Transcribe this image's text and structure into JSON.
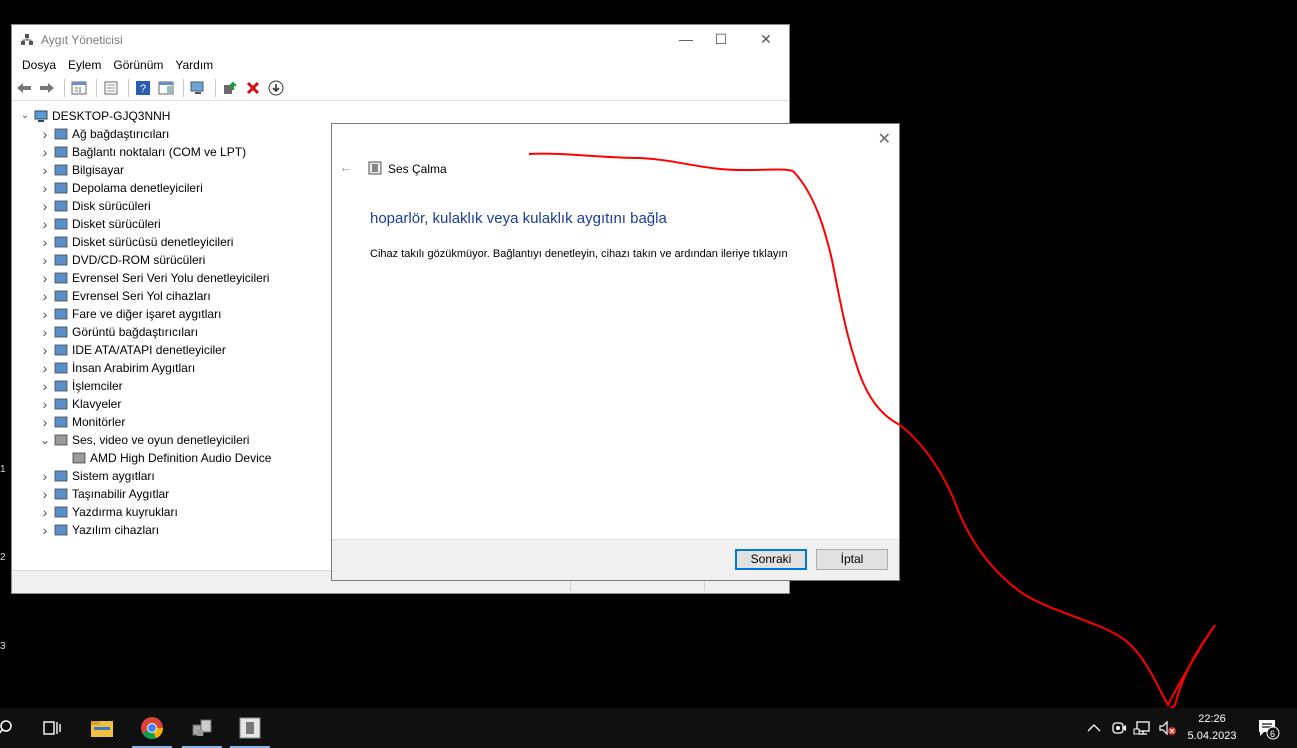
{
  "desktop": {
    "edge_glyphs": [
      "1",
      "2",
      "3"
    ]
  },
  "devmgr": {
    "title": "Aygıt Yöneticisi",
    "menu": [
      "Dosya",
      "Eylem",
      "Görünüm",
      "Yardım"
    ],
    "tree": {
      "root": "DESKTOP-GJQ3NNH",
      "items": [
        {
          "label": "Ağ bağdaştırıcıları",
          "icon": "network-adapter-icon"
        },
        {
          "label": "Bağlantı noktaları (COM ve LPT)",
          "icon": "port-icon"
        },
        {
          "label": "Bilgisayar",
          "icon": "computer-icon"
        },
        {
          "label": "Depolama denetleyicileri",
          "icon": "storage-icon"
        },
        {
          "label": "Disk sürücüleri",
          "icon": "disk-icon"
        },
        {
          "label": "Disket sürücüleri",
          "icon": "floppy-icon"
        },
        {
          "label": "Disket sürücüsü denetleyicileri",
          "icon": "floppy-controller-icon"
        },
        {
          "label": "DVD/CD-ROM sürücüleri",
          "icon": "dvd-icon"
        },
        {
          "label": "Evrensel Seri Veri Yolu denetleyicileri",
          "icon": "usb-icon"
        },
        {
          "label": "Evrensel Seri Yol cihazları",
          "icon": "usb-device-icon"
        },
        {
          "label": "Fare ve diğer işaret aygıtları",
          "icon": "mouse-icon"
        },
        {
          "label": "Görüntü bağdaştırıcıları",
          "icon": "display-adapter-icon"
        },
        {
          "label": "IDE ATA/ATAPI denetleyiciler",
          "icon": "ide-icon"
        },
        {
          "label": "İnsan Arabirim Aygıtları",
          "icon": "hid-icon"
        },
        {
          "label": "İşlemciler",
          "icon": "processor-icon"
        },
        {
          "label": "Klavyeler",
          "icon": "keyboard-icon"
        },
        {
          "label": "Monitörler",
          "icon": "monitor-icon"
        },
        {
          "label": "Ses, video ve oyun denetleyicileri",
          "icon": "speaker-icon"
        },
        {
          "label": "AMD High Definition Audio Device",
          "icon": "audio-device-icon"
        },
        {
          "label": "Sistem aygıtları",
          "icon": "system-icon"
        },
        {
          "label": "Taşınabilir Aygıtlar",
          "icon": "portable-icon"
        },
        {
          "label": "Yazdırma kuyrukları",
          "icon": "printer-icon"
        },
        {
          "label": "Yazılım cihazları",
          "icon": "software-device-icon"
        }
      ]
    }
  },
  "dialog": {
    "title": "Ses Çalma",
    "heading": "hoparlör, kulaklık veya kulaklık aygıtını bağla",
    "body": "Cihaz takılı gözükmüyor. Bağlantıyı denetleyin, cihazı takın ve ardından ileriye tıklayın",
    "next_label": "Sonraki",
    "cancel_label": "İptal"
  },
  "taskbar": {
    "time": "22:26",
    "date": "5.04.2023",
    "notification_count": "6"
  },
  "colors": {
    "annotation": "#ff0000",
    "accent": "#0078d7",
    "heading": "#1a3d9c"
  }
}
